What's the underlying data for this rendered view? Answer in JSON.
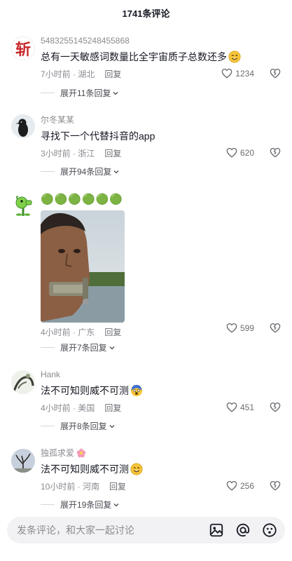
{
  "header": {
    "title": "1741条评论"
  },
  "comments": [
    {
      "username": "5483255145248455868",
      "text": "总有一天敏感词数量比全宇宙质子总数还多",
      "time_location": "7小时前 · 湖北",
      "reply_label": "回复",
      "likes": "1234",
      "expand": "展开11条回复",
      "avatar_char": "斩"
    },
    {
      "username": "尔冬某某",
      "text": "寻找下一个代替抖音的app",
      "time_location": "3小时前 · 浙江",
      "reply_label": "回复",
      "likes": "620",
      "expand": "展开94条回复"
    },
    {
      "username": "",
      "text": "🟢🟢🟢🟢🟢🟢",
      "time_location": "4小时前 · 广东",
      "reply_label": "回复",
      "likes": "599",
      "expand": "展开7条回复"
    },
    {
      "username": "Hank",
      "text": "法不可知则威不可测",
      "time_location": "4小时前 · 美国",
      "reply_label": "回复",
      "likes": "451",
      "expand": "展开8条回复"
    },
    {
      "username": "独孤求爱",
      "text": "法不可知则威不可测",
      "time_location": "10小时前 · 河南",
      "reply_label": "回复",
      "likes": "256",
      "expand": "展开19条回复"
    }
  ],
  "input": {
    "placeholder": "发条评论，和大家一起讨论"
  },
  "icons": {
    "like": "heart-icon",
    "dislike": "broken-heart-icon",
    "image": "image-icon",
    "mention": "at-icon",
    "emoji": "emoji-icon"
  },
  "colors": {
    "avatar_red": "#c8282d",
    "green_dot": "#3fbf3a"
  }
}
